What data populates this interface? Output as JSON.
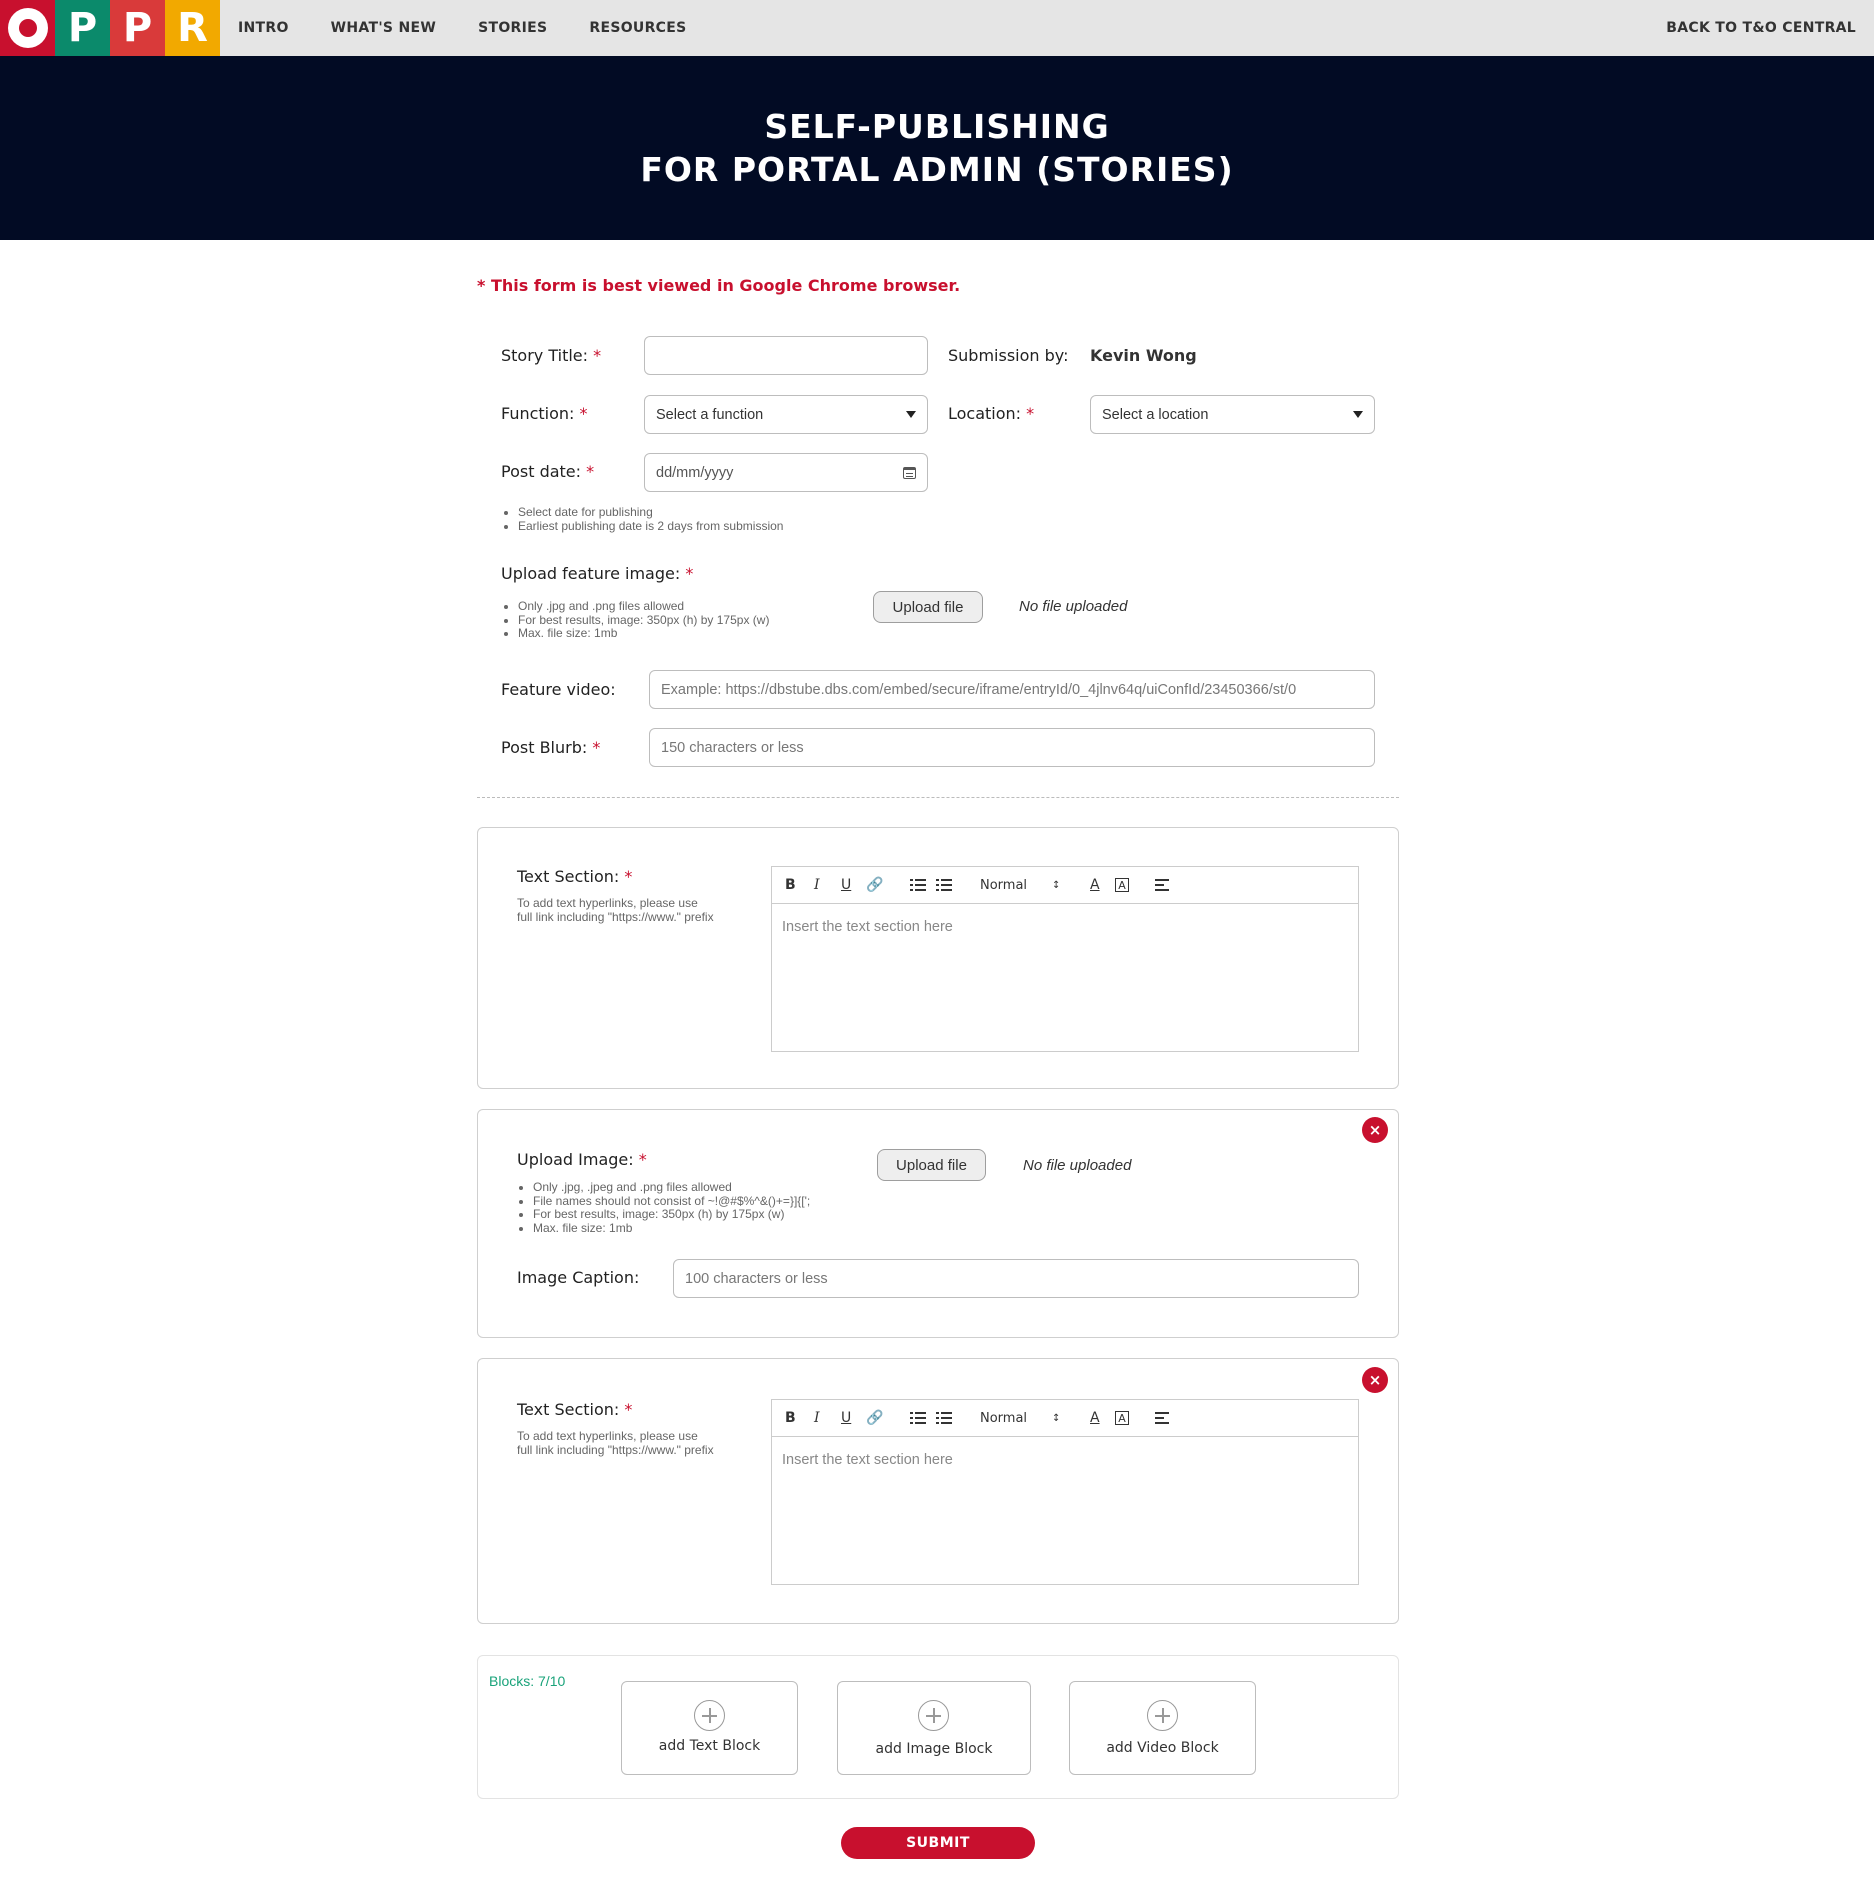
{
  "logo": {
    "letters": [
      "P",
      "P",
      "R"
    ],
    "colors": [
      "#c8102e",
      "#0b8a6b",
      "#d93a3a",
      "#f2a900"
    ]
  },
  "nav": {
    "links": [
      "INTRO",
      "WHAT'S NEW",
      "STORIES",
      "RESOURCES"
    ],
    "back_link": "BACK TO T&O CENTRAL"
  },
  "hero": {
    "line1": "SELF-PUBLISHING",
    "line2": "FOR PORTAL ADMIN (STORIES)",
    "background": "#020b24"
  },
  "form": {
    "notice": "* This form is best viewed in Google Chrome browser.",
    "required_mark": "*",
    "story_title": {
      "label": "Story Title:",
      "value": ""
    },
    "submission_by": {
      "label": "Submission by:",
      "value": "Kevin Wong"
    },
    "function": {
      "label": "Function:",
      "value": "Select a function"
    },
    "location": {
      "label": "Location:",
      "value": "Select a location"
    },
    "post_date": {
      "label": "Post date:",
      "placeholder": "dd/mm/yyyy",
      "hints": [
        "Select date for publishing",
        "Earliest publishing date is 2 days from submission"
      ]
    },
    "feature_image": {
      "label": "Upload feature image:",
      "hints": [
        "Only .jpg and .png files allowed",
        "For best results, image: 350px (h) by 175px (w)",
        "Max. file size: 1mb"
      ],
      "button": "Upload file",
      "status": "No file uploaded"
    },
    "feature_video": {
      "label": "Feature video:",
      "placeholder": "Example: https://dbstube.dbs.com/embed/secure/iframe/entryId/0_4jlnv64q/uiConfId/23450366/st/0"
    },
    "post_blurb": {
      "label": "Post Blurb:",
      "placeholder": "150 characters or less"
    }
  },
  "blocks": {
    "text_section_1": {
      "label": "Text Section:",
      "hint": [
        "To add text hyperlinks, please use",
        "full link including \"https://www.\" prefix"
      ],
      "format": "Normal",
      "placeholder": "Insert the text section here"
    },
    "image_section": {
      "label": "Upload Image:",
      "hints": [
        "Only .jpg, .jpeg and .png files allowed",
        "File names should not consist of ~!@#$%^&()+=}]{[';",
        "For best results, image: 350px (h) by 175px (w)",
        "Max. file size: 1mb"
      ],
      "button": "Upload file",
      "status": "No file uploaded",
      "caption_label": "Image Caption:",
      "caption_placeholder": "100 characters or less"
    },
    "text_section_2": {
      "label": "Text Section:",
      "hint": [
        "To add text hyperlinks, please use",
        "full link including \"https://www.\" prefix"
      ],
      "format": "Normal",
      "placeholder": "Insert the text section here"
    },
    "toolbar": {
      "bold": "B",
      "italic": "I",
      "underline": "U",
      "color": "A"
    },
    "remove_icon": "×",
    "count": "Blocks: 7/10",
    "add": {
      "text": "add Text Block",
      "image": "add Image Block",
      "video": "add Video Block"
    }
  },
  "submit_label": "SUBMIT",
  "colors": {
    "accent": "#c8102e",
    "count_green": "#1aa37a",
    "nav_bg": "#e5e5e5"
  }
}
